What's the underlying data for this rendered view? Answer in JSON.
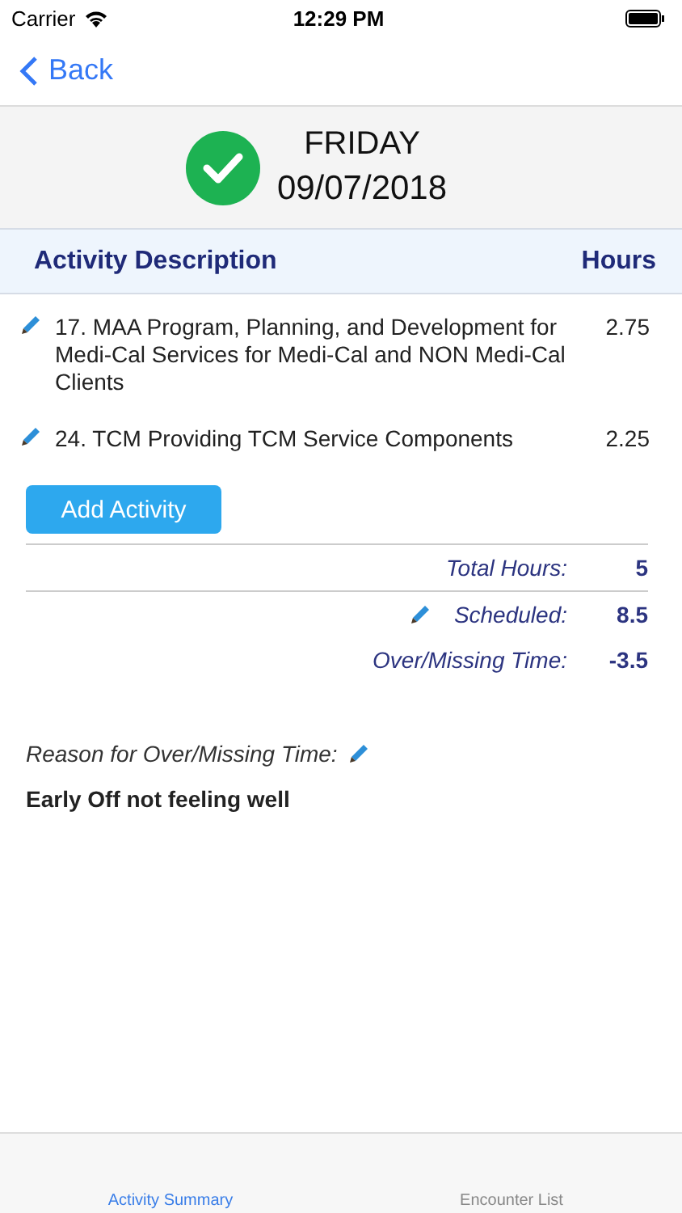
{
  "status_bar": {
    "carrier": "Carrier",
    "time": "12:29 PM"
  },
  "nav": {
    "back": "Back"
  },
  "day": {
    "weekday": "FRIDAY",
    "date": "09/07/2018",
    "completed": true
  },
  "table": {
    "columns": [
      "Activity Description",
      "Hours"
    ],
    "rows": [
      {
        "description": "17. MAA Program, Planning, and Development for Medi-Cal Services for Medi-Cal and NON Medi-Cal Clients",
        "hours": "2.75"
      },
      {
        "description": "24. TCM Providing TCM Service Components",
        "hours": "2.25"
      }
    ]
  },
  "add_button": "Add Activity",
  "totals": [
    {
      "label": "Total Hours:",
      "value": "5",
      "editable": false
    },
    {
      "label": "Scheduled:",
      "value": "8.5",
      "editable": true
    },
    {
      "label": "Over/Missing Time:",
      "value": "-3.5",
      "editable": false
    }
  ],
  "reason": {
    "label": "Reason for Over/Missing Time:",
    "text": "Early Off not feeling well"
  },
  "tabs": [
    {
      "label": "Activity Summary",
      "selected": true
    },
    {
      "label": "Encounter List",
      "selected": false
    }
  ]
}
